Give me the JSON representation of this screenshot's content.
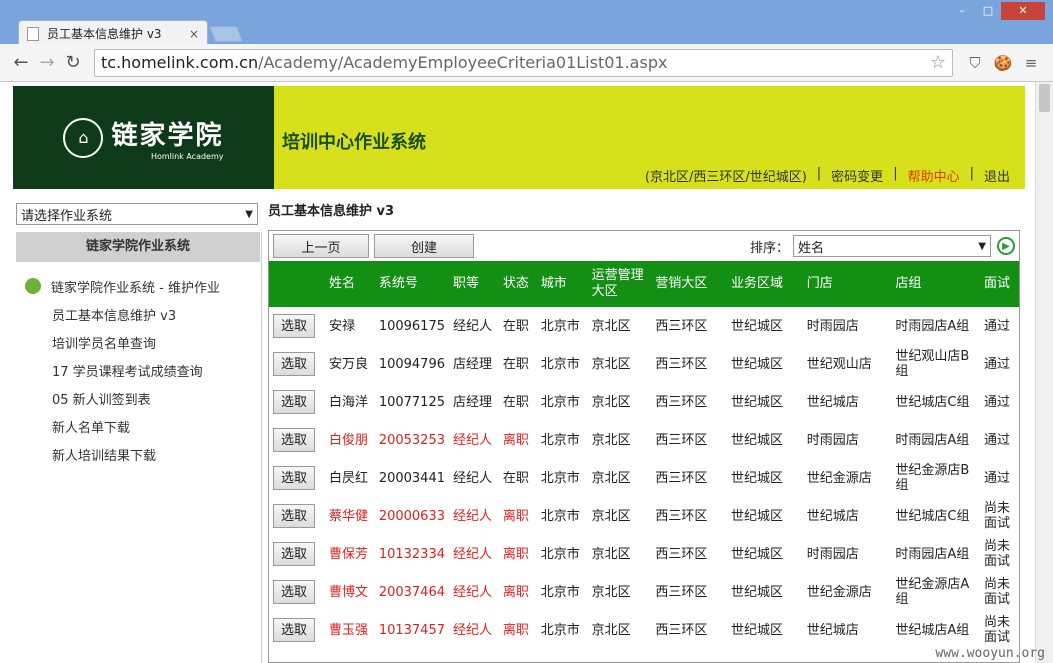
{
  "browser": {
    "tab_title": "员工基本信息维护 v3",
    "tab_close": "×",
    "window_buttons": [
      "–",
      "□",
      "✕"
    ],
    "back": "←",
    "forward": "→",
    "reload": "↻",
    "url_host": "tc.homelink.com.cn",
    "url_path": "/Academy/AcademyEmployeeCriteria01List01.aspx",
    "star": "☆",
    "ext1": "⛉",
    "ext2": "🍪",
    "menu": "≡"
  },
  "header": {
    "logo_main": "链家学院",
    "logo_sub": "Homlink Academy",
    "logo_emblem": "⌂",
    "system_title": "培训中心作业系统",
    "links": [
      "(京北区/西三环区/世纪城区)",
      "|",
      "密码变更",
      "|",
      "帮助中心",
      "|",
      "退出"
    ]
  },
  "sidebar": {
    "select_value": "请选择作业系统",
    "select_arrow": "▼",
    "header": "链家学院作业系统",
    "root_item": "链家学院作业系统 - 维护作业",
    "items": [
      "员工基本信息维护 v3",
      "培训学员名单查询",
      "17 学员课程考试成绩查询",
      "05 新人训签到表",
      "新人名单下载",
      "新人培训结果下载"
    ]
  },
  "main": {
    "heading": "员工基本信息维护 v3",
    "prev_button": "上一页",
    "create_button": "创建",
    "sort_label": "排序：",
    "sort_value": "姓名",
    "sort_arrow": "▼",
    "go_icon": "▶",
    "columns": [
      "",
      "姓名",
      "系统号",
      "职等",
      "状态",
      "城市",
      "运营管理大区",
      "营销大区",
      "业务区域",
      "门店",
      "店组",
      "面试"
    ],
    "row_button": "选取",
    "rows": [
      {
        "name": "安禄",
        "id": "10096175",
        "grade": "经纪人",
        "status": "在职",
        "city": "北京市",
        "ops": "京北区",
        "sales": "西三环区",
        "area": "世纪城区",
        "store": "时雨园店",
        "group": "时雨园店A组",
        "interview": "通过",
        "resigned": false
      },
      {
        "name": "安万良",
        "id": "10094796",
        "grade": "店经理",
        "status": "在职",
        "city": "北京市",
        "ops": "京北区",
        "sales": "西三环区",
        "area": "世纪城区",
        "store": "世纪观山店",
        "group": "世纪观山店B组",
        "interview": "通过",
        "resigned": false
      },
      {
        "name": "白海洋",
        "id": "10077125",
        "grade": "店经理",
        "status": "在职",
        "city": "北京市",
        "ops": "京北区",
        "sales": "西三环区",
        "area": "世纪城区",
        "store": "世纪城店",
        "group": "世纪城店C组",
        "interview": "通过",
        "resigned": false
      },
      {
        "name": "白俊朋",
        "id": "20053253",
        "grade": "经纪人",
        "status": "离职",
        "city": "北京市",
        "ops": "京北区",
        "sales": "西三环区",
        "area": "世纪城区",
        "store": "时雨园店",
        "group": "时雨园店A组",
        "interview": "通过",
        "resigned": true
      },
      {
        "name": "白昃红",
        "id": "20003441",
        "grade": "经纪人",
        "status": "在职",
        "city": "北京市",
        "ops": "京北区",
        "sales": "西三环区",
        "area": "世纪城区",
        "store": "世纪金源店",
        "group": "世纪金源店B组",
        "interview": "通过",
        "resigned": false
      },
      {
        "name": "蔡华健",
        "id": "20000633",
        "grade": "经纪人",
        "status": "离职",
        "city": "北京市",
        "ops": "京北区",
        "sales": "西三环区",
        "area": "世纪城区",
        "store": "世纪城店",
        "group": "世纪城店C组",
        "interview": "尚未面试",
        "resigned": true
      },
      {
        "name": "曹保芳",
        "id": "10132334",
        "grade": "经纪人",
        "status": "离职",
        "city": "北京市",
        "ops": "京北区",
        "sales": "西三环区",
        "area": "世纪城区",
        "store": "时雨园店",
        "group": "时雨园店A组",
        "interview": "尚未面试",
        "resigned": true
      },
      {
        "name": "曹博文",
        "id": "20037464",
        "grade": "经纪人",
        "status": "离职",
        "city": "北京市",
        "ops": "京北区",
        "sales": "西三环区",
        "area": "世纪城区",
        "store": "世纪金源店",
        "group": "世纪金源店A组",
        "interview": "尚未面试",
        "resigned": true
      },
      {
        "name": "曹玉强",
        "id": "10137457",
        "grade": "经纪人",
        "status": "离职",
        "city": "北京市",
        "ops": "京北区",
        "sales": "西三环区",
        "area": "世纪城区",
        "store": "世纪城店",
        "group": "世纪城店A组",
        "interview": "尚未面试",
        "resigned": true
      }
    ]
  },
  "watermark": "www.wooyun.org",
  "colors": {
    "banner": "#d6e11c",
    "logo_bg": "#0f3a19",
    "table_header": "#139013",
    "resigned_text": "#e31e1e",
    "help_link": "#e03b00"
  }
}
